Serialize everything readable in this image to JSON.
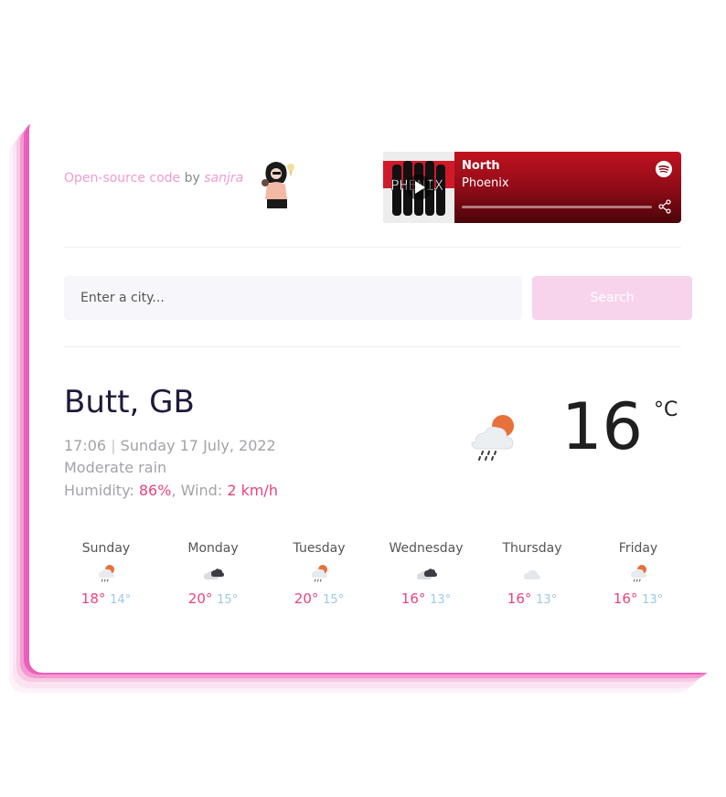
{
  "credit": {
    "link_text": "Open-source code",
    "by": "by",
    "author": "sanjra"
  },
  "spotify": {
    "track": "North",
    "artist": "Phoenix",
    "icons": [
      "play-icon",
      "spotify-icon",
      "share-icon"
    ]
  },
  "search": {
    "placeholder": "Enter a city...",
    "button_label": "Search"
  },
  "current": {
    "city": "Butt, GB",
    "time": "17:06",
    "date": "Sunday 17 July, 2022",
    "description": "Moderate rain",
    "humidity_label": "Humidity:",
    "humidity_value": "86%",
    "wind_label": "Wind:",
    "wind_value": "2 km/h",
    "temperature": "16",
    "unit": "°C",
    "icon": "cloud-sun-rain-icon"
  },
  "forecast": [
    {
      "day": "Sunday",
      "max": "18°",
      "min": "14°",
      "icon": "cloud-sun-rain-icon"
    },
    {
      "day": "Monday",
      "max": "20°",
      "min": "15°",
      "icon": "dark-clouds-icon"
    },
    {
      "day": "Tuesday",
      "max": "20°",
      "min": "15°",
      "icon": "cloud-sun-rain-icon"
    },
    {
      "day": "Wednesday",
      "max": "16°",
      "min": "13°",
      "icon": "dark-clouds-icon"
    },
    {
      "day": "Thursday",
      "max": "16°",
      "min": "13°",
      "icon": "cloud-icon"
    },
    {
      "day": "Friday",
      "max": "16°",
      "min": "13°",
      "icon": "cloud-sun-rain-icon"
    }
  ],
  "colors": {
    "accent": "#e8447d",
    "pink": "#f29bd1",
    "min_temp": "#9ec8ea",
    "title": "#1f1a3a"
  }
}
